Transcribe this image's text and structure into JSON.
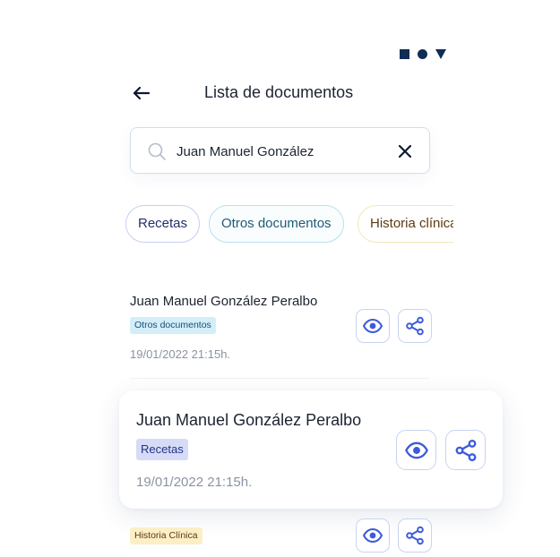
{
  "header": {
    "title": "Lista de documentos"
  },
  "search": {
    "value": "Juan Manuel González",
    "placeholder": ""
  },
  "filters": [
    {
      "label": "Recetas"
    },
    {
      "label": "Otros documentos"
    },
    {
      "label": "Historia clínica"
    }
  ],
  "documents": [
    {
      "name": "Juan Manuel González Peralbo",
      "category": "Otros documentos",
      "date": "19/01/2022  21:15h."
    },
    {
      "name": "Juan Manuel González Peralbo",
      "category": "Recetas",
      "date": "19/01/2022  21:15h."
    },
    {
      "category": "Historia Clínica"
    }
  ],
  "icons": {
    "status": [
      "square-icon",
      "circle-icon",
      "triangle-icon"
    ],
    "back": "arrow-left-icon",
    "search": "search-icon",
    "clear": "close-icon",
    "view": "eye-icon",
    "share": "share-icon"
  },
  "colors": {
    "accent": "#3d5bd9",
    "status_icons": "#0f2d57",
    "text": "#1c2331",
    "muted": "#8a93a3"
  }
}
